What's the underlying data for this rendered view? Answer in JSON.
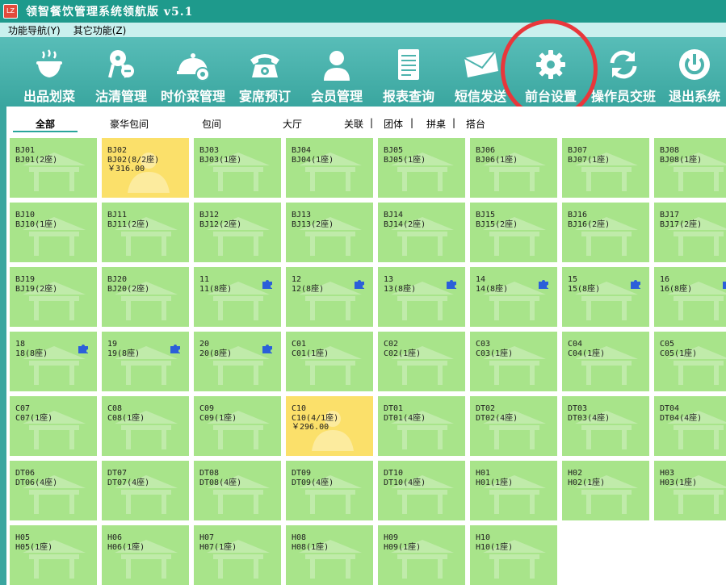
{
  "window": {
    "title": "领智餐饮管理系统领航版  v5.1",
    "logo_text": "LZ"
  },
  "menu": [
    {
      "label": "功能导航(Y)"
    },
    {
      "label": "其它功能(Z)"
    }
  ],
  "toolbar": [
    {
      "label": "出品划菜",
      "icon": "bowl-icon"
    },
    {
      "label": "沽清管理",
      "icon": "price-tag-icon"
    },
    {
      "label": "时价菜管理",
      "icon": "serving-dish-gear-icon"
    },
    {
      "label": "宴席预订",
      "icon": "telephone-icon"
    },
    {
      "label": "会员管理",
      "icon": "user-icon"
    },
    {
      "label": "报表查询",
      "icon": "document-icon"
    },
    {
      "label": "短信发送",
      "icon": "envelope-icon"
    },
    {
      "label": "前台设置",
      "icon": "gear-icon"
    },
    {
      "label": "操作员交班",
      "icon": "refresh-icon"
    },
    {
      "label": "退出系统",
      "icon": "power-icon"
    }
  ],
  "tabs": [
    {
      "label": "全部",
      "active": true
    },
    {
      "label": "豪华包间"
    },
    {
      "label": "包间"
    },
    {
      "label": "大厅"
    },
    {
      "label": "关联"
    },
    {
      "label": "团体"
    },
    {
      "label": "拼桌"
    },
    {
      "label": "搭台"
    }
  ],
  "tab_separator": "|",
  "colors": {
    "titlebar": "#1e9a8c",
    "toolbar": "#4cb3ad",
    "card_free": "#a8e48a",
    "card_occupied": "#fbe06a",
    "highlight": "#e8373b"
  },
  "tables": [
    {
      "code": "BJ01",
      "line2": "BJ01(2座)"
    },
    {
      "code": "BJ02",
      "line2": "BJ02(8/2座)",
      "amount": "￥316.00",
      "status": "occupied"
    },
    {
      "code": "BJ03",
      "line2": "BJ03(1座)"
    },
    {
      "code": "BJ04",
      "line2": "BJ04(1座)"
    },
    {
      "code": "BJ05",
      "line2": "BJ05(1座)"
    },
    {
      "code": "BJ06",
      "line2": "BJ06(1座)"
    },
    {
      "code": "BJ07",
      "line2": "BJ07(1座)"
    },
    {
      "code": "BJ08",
      "line2": "BJ08(1座)"
    },
    {
      "code": "BJ10",
      "line2": "BJ10(1座)"
    },
    {
      "code": "BJ11",
      "line2": "BJ11(2座)"
    },
    {
      "code": "BJ12",
      "line2": "BJ12(2座)"
    },
    {
      "code": "BJ13",
      "line2": "BJ13(2座)"
    },
    {
      "code": "BJ14",
      "line2": "BJ14(2座)"
    },
    {
      "code": "BJ15",
      "line2": "BJ15(2座)"
    },
    {
      "code": "BJ16",
      "line2": "BJ16(2座)"
    },
    {
      "code": "BJ17",
      "line2": "BJ17(2座)"
    },
    {
      "code": "BJ19",
      "line2": "BJ19(2座)"
    },
    {
      "code": "BJ20",
      "line2": "BJ20(2座)"
    },
    {
      "code": "11",
      "line2": "11(8座)",
      "linked": true
    },
    {
      "code": "12",
      "line2": "12(8座)",
      "linked": true
    },
    {
      "code": "13",
      "line2": "13(8座)",
      "linked": true
    },
    {
      "code": "14",
      "line2": "14(8座)",
      "linked": true
    },
    {
      "code": "15",
      "line2": "15(8座)",
      "linked": true
    },
    {
      "code": "16",
      "line2": "16(8座)",
      "linked": true
    },
    {
      "code": "18",
      "line2": "18(8座)",
      "linked": true
    },
    {
      "code": "19",
      "line2": "19(8座)",
      "linked": true
    },
    {
      "code": "20",
      "line2": "20(8座)",
      "linked": true
    },
    {
      "code": "C01",
      "line2": "C01(1座)"
    },
    {
      "code": "C02",
      "line2": "C02(1座)"
    },
    {
      "code": "C03",
      "line2": "C03(1座)"
    },
    {
      "code": "C04",
      "line2": "C04(1座)"
    },
    {
      "code": "C05",
      "line2": "C05(1座)"
    },
    {
      "code": "C07",
      "line2": "C07(1座)"
    },
    {
      "code": "C08",
      "line2": "C08(1座)"
    },
    {
      "code": "C09",
      "line2": "C09(1座)"
    },
    {
      "code": "C10",
      "line2": "C10(4/1座)",
      "amount": "￥296.00",
      "status": "occupied"
    },
    {
      "code": "DT01",
      "line2": "DT01(4座)"
    },
    {
      "code": "DT02",
      "line2": "DT02(4座)"
    },
    {
      "code": "DT03",
      "line2": "DT03(4座)"
    },
    {
      "code": "DT04",
      "line2": "DT04(4座)"
    },
    {
      "code": "DT06",
      "line2": "DT06(4座)"
    },
    {
      "code": "DT07",
      "line2": "DT07(4座)"
    },
    {
      "code": "DT08",
      "line2": "DT08(4座)"
    },
    {
      "code": "DT09",
      "line2": "DT09(4座)"
    },
    {
      "code": "DT10",
      "line2": "DT10(4座)"
    },
    {
      "code": "H01",
      "line2": "H01(1座)"
    },
    {
      "code": "H02",
      "line2": "H02(1座)"
    },
    {
      "code": "H03",
      "line2": "H03(1座)"
    },
    {
      "code": "H05",
      "line2": "H05(1座)"
    },
    {
      "code": "H06",
      "line2": "H06(1座)"
    },
    {
      "code": "H07",
      "line2": "H07(1座)"
    },
    {
      "code": "H08",
      "line2": "H08(1座)"
    },
    {
      "code": "H09",
      "line2": "H09(1座)"
    },
    {
      "code": "H10",
      "line2": "H10(1座)"
    }
  ]
}
